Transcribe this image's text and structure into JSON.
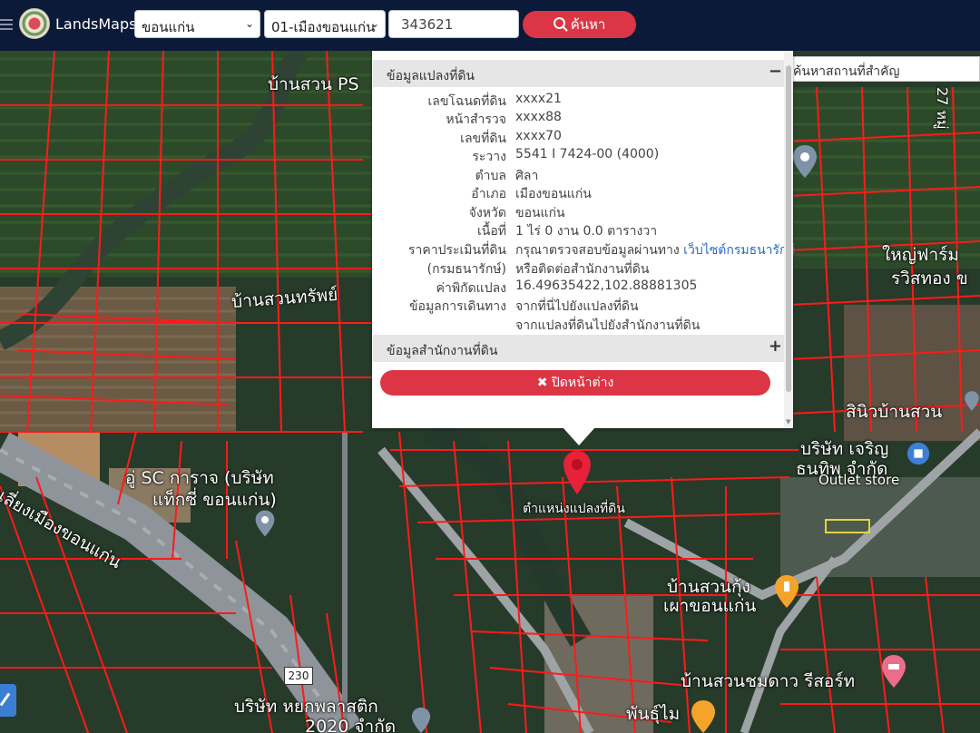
{
  "header": {
    "brand": "LandsMaps",
    "province_select": "ขอนแก่น",
    "district_select": "01-เมืองขอนแก่น",
    "parcel_number": "343621",
    "search_button": "ค้นหา"
  },
  "landmark_search": {
    "placeholder": "ค้นหาสถานที่สำคัญ"
  },
  "popup": {
    "parcel_section_title": "ข้อมูลแปลงที่ดิน",
    "parcel_section_sign": "−",
    "rows": [
      {
        "label": "เลขโฉนดที่ดิน",
        "value": "xxxx21"
      },
      {
        "label": "หน้าสำรวจ",
        "value": "xxxx88"
      },
      {
        "label": "เลขที่ดิน",
        "value": "xxxx70"
      },
      {
        "label": "ระวาง",
        "value": "5541 I 7424-00 (4000)"
      },
      {
        "label": "ตำบล",
        "value": "ศิลา"
      },
      {
        "label": "อำเภอ",
        "value": "เมืองขอนแก่น"
      },
      {
        "label": "จังหวัด",
        "value": "ขอนแก่น"
      },
      {
        "label": "เนื้อที่",
        "value": "1 ไร่ 0 งาน 0.0 ตารางวา"
      }
    ],
    "appraisal": {
      "label_line1": "ราคาประเมินที่ดิน",
      "label_line2": "(กรมธนารักษ์)",
      "value_prefix": "กรุณาตรวจสอบข้อมูลผ่านทาง ",
      "value_link": "เว็บไซต์กรมธนารักษ์",
      "value_line2": "หรือติดต่อสำนักงานที่ดิน"
    },
    "coords": {
      "label": "ค่าพิกัดแปลง",
      "value": "16.49635422,102.88881305"
    },
    "travel": {
      "label": "ข้อมูลการเดินทาง",
      "link1": "จากที่นี่ไปยังแปลงที่ดิน",
      "link2": "จากแปลงที่ดินไปยังสำนักงานที่ดิน"
    },
    "office_section_title": "ข้อมูลสำนักงานที่ดิน",
    "office_section_sign": "+",
    "close_button": "ปิดหน้าต่าง"
  },
  "map": {
    "pin_label": "ตำแหน่งแปลงที่ดิน",
    "road_sign": "230",
    "labels": [
      "บ้านสวน PS",
      "บ้านสวนทรัพย์",
      "อู่ SC การาจ (บริษัท",
      "แท็กซี่ ขอนแก่น)",
      "นเลี่ยงเมืองขอนแก่น",
      "สินิวบ้านสวน",
      "บริษัท เจริญ",
      "ธนทิพ จำกัด",
      "Outlet store",
      "บ้านสวนกุ้ง",
      "เผาขอนแก่น",
      "บ้านสวนชมดาว รีสอร์ท",
      "บริษัท หยกพลาสติก",
      "2020 จำกัด",
      "พันธุ์ไม",
      "ใหญ่ฟาร์ม",
      "รวิสทอง ข",
      "27 หมู่"
    ]
  }
}
